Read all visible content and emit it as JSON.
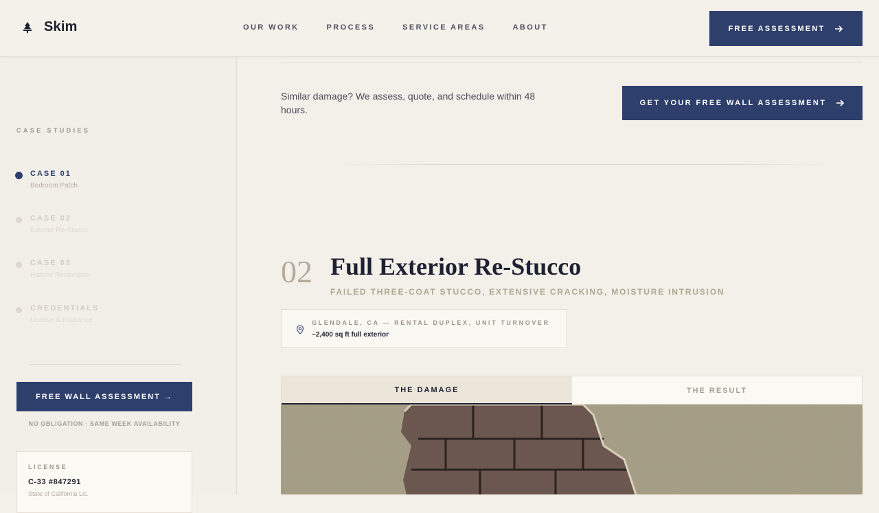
{
  "header": {
    "brand": "Skim",
    "nav": [
      "OUR WORK",
      "PROCESS",
      "SERVICE AREAS",
      "ABOUT"
    ],
    "cta_label": "FREE ASSESSMENT"
  },
  "sidebar": {
    "heading": "CASE STUDIES",
    "items": [
      {
        "title": "CASE 01",
        "subtitle": "Bedroom Patch",
        "active": true
      },
      {
        "title": "CASE 02",
        "subtitle": "Exterior Re-Stucco",
        "active": false
      },
      {
        "title": "CASE 03",
        "subtitle": "Historic Restoration",
        "active": false
      },
      {
        "title": "CREDENTIALS",
        "subtitle": "License & Insurance",
        "active": false
      }
    ],
    "cta_label": "FREE WALL ASSESSMENT →",
    "note": "NO OBLIGATION · SAME WEEK AVAILABILITY",
    "license": {
      "label": "LICENSE",
      "number": "C-33 #847291",
      "sub": "State of California Lic."
    }
  },
  "main": {
    "similar_text": "Similar damage? We assess, quote, and schedule within 48 hours.",
    "cta_label": "GET YOUR FREE WALL ASSESSMENT",
    "case": {
      "number": "02",
      "title": "Full Exterior Re-Stucco",
      "tagline": "FAILED THREE-COAT STUCCO, EXTENSIVE CRACKING, MOISTURE INTRUSION",
      "location": "GLENDALE, CA — RENTAL DUPLEX, UNIT TURNOVER",
      "size": "~2,400 sq ft full exterior"
    },
    "tabs": [
      "THE DAMAGE",
      "THE RESULT"
    ],
    "active_tab": "THE DAMAGE"
  },
  "colors": {
    "accent": "#2e3f6c",
    "background": "#f3efe9",
    "muted_text": "#b1a892"
  }
}
